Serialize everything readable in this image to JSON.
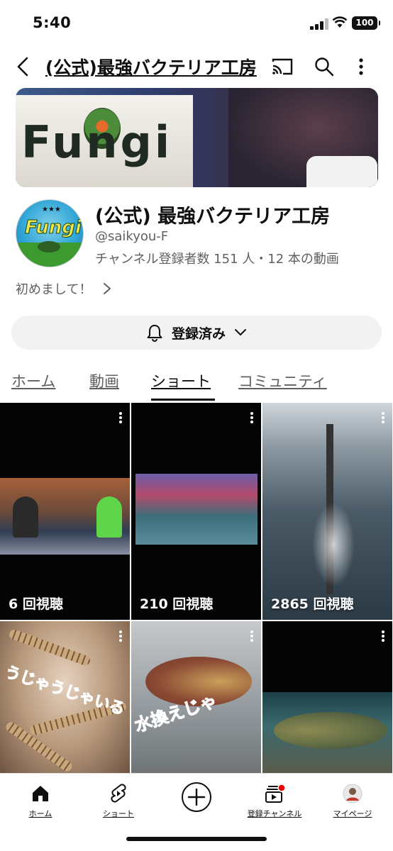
{
  "status_bar": {
    "time": "5:40",
    "battery": "100"
  },
  "header": {
    "title": "(公式)最強バクテリア工房"
  },
  "banner": {
    "sign_text": "Fungi"
  },
  "channel": {
    "avatar_text": "Fungi",
    "avatar_stars": "★★★",
    "name": "(公式) 最強バクテリア工房",
    "handle": "@saikyou-F",
    "stats": "チャンネル登録者数 151 人・12 本の動画",
    "description": "初めまして！"
  },
  "subscribe": {
    "label": "登録済み"
  },
  "tabs": [
    {
      "label": "ホーム"
    },
    {
      "label": "動画"
    },
    {
      "label": "ショート"
    },
    {
      "label": "コミュニティ"
    }
  ],
  "shorts": [
    {
      "views": "6 回視聴"
    },
    {
      "views": "210 回視聴"
    },
    {
      "views": "2865 回視聴"
    },
    {
      "views": "",
      "caption": "うじゃうじゃいる"
    },
    {
      "views": "",
      "caption": "水換えじゃ"
    },
    {
      "views": ""
    }
  ],
  "bottom_nav": [
    {
      "label": "ホーム",
      "icon": "home-icon"
    },
    {
      "label": "ショート",
      "icon": "shorts-icon"
    },
    {
      "label": "",
      "icon": "create-icon"
    },
    {
      "label": "登録チャンネル",
      "icon": "subscriptions-icon"
    },
    {
      "label": "マイページ",
      "icon": "avatar-icon"
    }
  ]
}
